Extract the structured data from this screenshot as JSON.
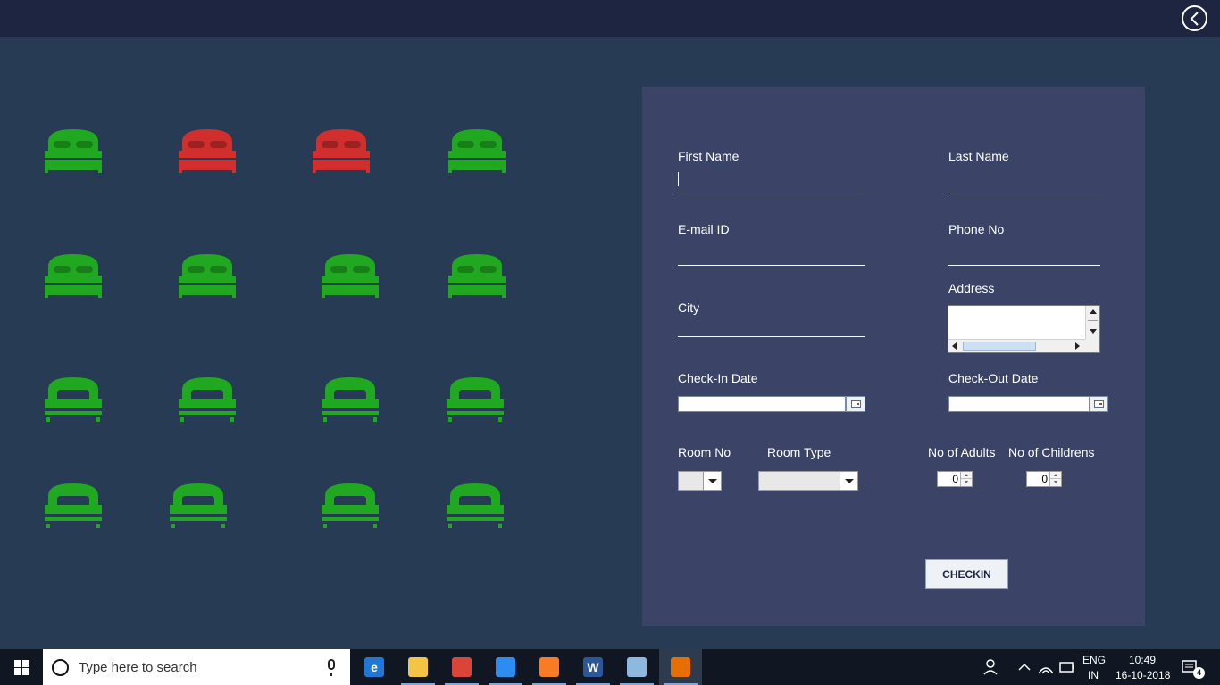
{
  "colors": {
    "room_available": "#21a821",
    "room_occupied": "#d12e2e",
    "background": "#273b55",
    "panel": "#3b4467",
    "topbar": "#1d2540"
  },
  "topbar": {
    "back_icon": "back-arrow-circle-icon"
  },
  "rooms": [
    {
      "type": "double",
      "status": "available"
    },
    {
      "type": "double",
      "status": "occupied"
    },
    {
      "type": "double",
      "status": "occupied"
    },
    {
      "type": "double",
      "status": "available"
    },
    {
      "type": "double",
      "status": "available"
    },
    {
      "type": "double",
      "status": "available"
    },
    {
      "type": "double",
      "status": "available"
    },
    {
      "type": "double",
      "status": "available"
    },
    {
      "type": "single",
      "status": "available"
    },
    {
      "type": "single",
      "status": "available"
    },
    {
      "type": "single",
      "status": "available"
    },
    {
      "type": "single",
      "status": "available"
    },
    {
      "type": "single",
      "status": "available"
    },
    {
      "type": "single",
      "status": "available"
    },
    {
      "type": "single",
      "status": "available"
    },
    {
      "type": "single",
      "status": "available"
    }
  ],
  "form": {
    "first_name_label": "First Name",
    "first_name_value": "",
    "last_name_label": "Last Name",
    "last_name_value": "",
    "email_label": "E-mail ID",
    "email_value": "",
    "phone_label": "Phone No",
    "phone_value": "",
    "city_label": "City",
    "city_value": "",
    "address_label": "Address",
    "address_value": "",
    "checkin_date_label": "Check-In Date",
    "checkin_date_value": "",
    "checkout_date_label": "Check-Out Date",
    "checkout_date_value": "",
    "room_no_label": "Room No",
    "room_no_value": "",
    "room_type_label": "Room Type",
    "room_type_value": "",
    "adults_label": "No of Adults",
    "adults_value": "0",
    "children_label": "No of Childrens",
    "children_value": "0",
    "checkin_button": "CHECKIN"
  },
  "taskbar": {
    "search_placeholder": "Type here to search",
    "apps": [
      {
        "name": "edge",
        "icon": "edge-icon",
        "glyph": "e",
        "color": "#1e78d8",
        "running": false
      },
      {
        "name": "file-explorer",
        "icon": "folder-icon",
        "glyph": "",
        "color": "#f4c542",
        "running": true
      },
      {
        "name": "chrome",
        "icon": "chrome-icon",
        "glyph": "",
        "color": "#db4437",
        "running": true
      },
      {
        "name": "teamviewer",
        "icon": "sync-icon",
        "glyph": "",
        "color": "#2d8cf0",
        "running": true
      },
      {
        "name": "xampp",
        "icon": "xampp-icon",
        "glyph": "",
        "color": "#fb7a24",
        "running": true
      },
      {
        "name": "word",
        "icon": "word-icon",
        "glyph": "W",
        "color": "#2b579a",
        "running": true
      },
      {
        "name": "virtualbox",
        "icon": "cube-icon",
        "glyph": "",
        "color": "#8fb8de",
        "running": true
      },
      {
        "name": "java",
        "icon": "java-icon",
        "glyph": "",
        "color": "#e76f00",
        "running": true,
        "active": true
      }
    ],
    "language_line1": "ENG",
    "language_line2": "IN",
    "time": "10:49",
    "date": "16-10-2018",
    "notification_count": "4"
  }
}
